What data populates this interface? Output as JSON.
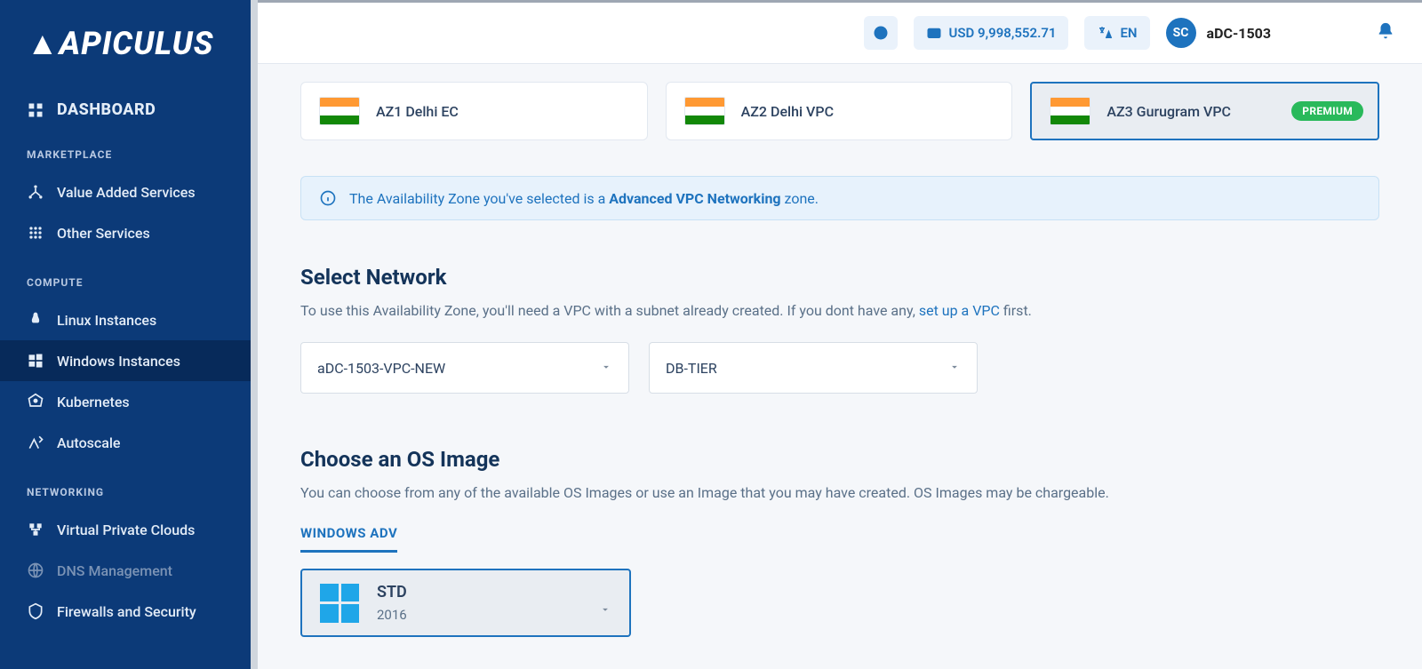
{
  "brand": "APICULUS",
  "sidebar": {
    "dashboard": "DASHBOARD",
    "sections": [
      {
        "heading": "MARKETPLACE",
        "items": [
          {
            "label": "Value Added Services",
            "icon": "hierarchy-icon"
          },
          {
            "label": "Other Services",
            "icon": "grid-icon"
          }
        ]
      },
      {
        "heading": "COMPUTE",
        "items": [
          {
            "label": "Linux Instances",
            "icon": "linux-icon"
          },
          {
            "label": "Windows Instances",
            "icon": "windows-icon",
            "active": true
          },
          {
            "label": "Kubernetes",
            "icon": "kube-icon"
          },
          {
            "label": "Autoscale",
            "icon": "autoscale-icon"
          }
        ]
      },
      {
        "heading": "NETWORKING",
        "items": [
          {
            "label": "Virtual Private Clouds",
            "icon": "vpc-icon"
          },
          {
            "label": "DNS Management",
            "icon": "dns-icon",
            "disabled": true
          },
          {
            "label": "Firewalls and Security",
            "icon": "firewall-icon"
          }
        ]
      }
    ]
  },
  "topbar": {
    "balance": "USD 9,998,552.71",
    "lang": "EN",
    "avatar_initials": "SC",
    "username": "aDC-1503"
  },
  "zones": [
    {
      "name": "AZ1 Delhi EC"
    },
    {
      "name": "AZ2 Delhi VPC"
    },
    {
      "name": "AZ3 Gurugram VPC",
      "badge": "PREMIUM",
      "selected": true
    }
  ],
  "info_banner": {
    "pre": "The Availability Zone you've selected is a ",
    "strong": "Advanced VPC Networking",
    "post": " zone."
  },
  "network": {
    "title": "Select Network",
    "sub_pre": "To use this Availability Zone, you'll need a VPC with a subnet already created. If you dont have any, ",
    "link": "set up a VPC",
    "sub_post": " first.",
    "vpc_value": "aDC-1503-VPC-NEW",
    "tier_value": "DB-TIER"
  },
  "os": {
    "title": "Choose an OS Image",
    "sub": "You can choose from any of the available OS Images or use an Image that you may have created. OS Images may be chargeable.",
    "tab": "WINDOWS ADV",
    "card_name": "STD",
    "card_version": "2016"
  }
}
